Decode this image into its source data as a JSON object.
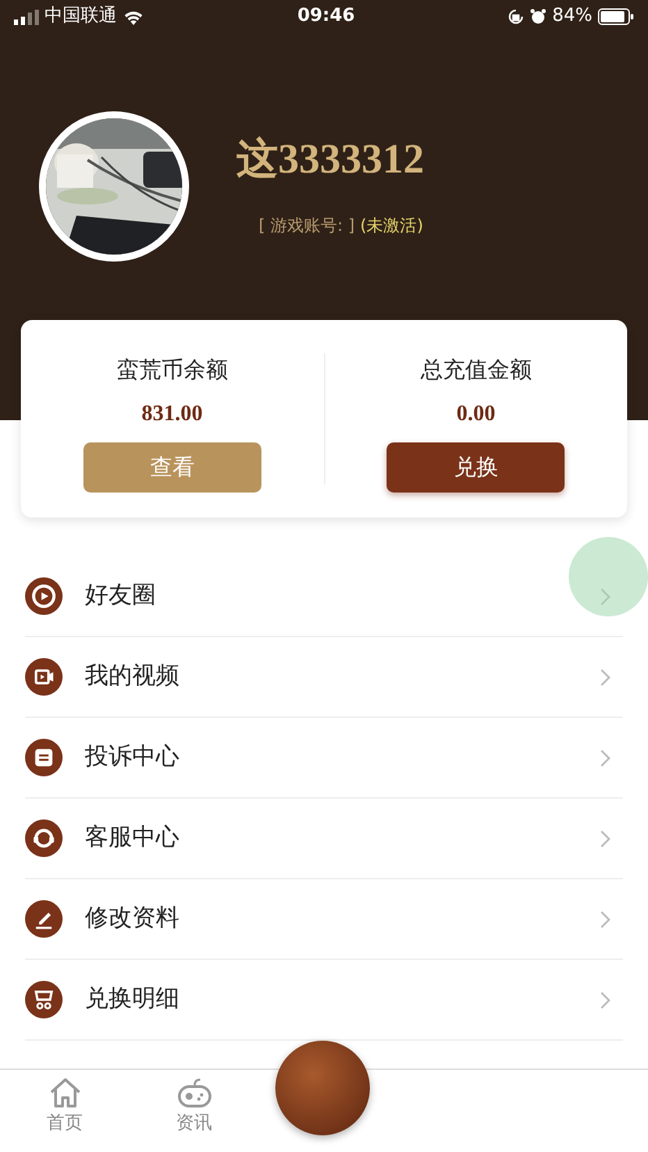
{
  "status_bar": {
    "carrier": "中国联通",
    "time": "09:46",
    "battery": "84%"
  },
  "profile": {
    "name": "这3333312",
    "account_label": "[ 游戏账号: ]",
    "account_status": "(未激活)"
  },
  "balances": [
    {
      "label": "蛮荒币余额",
      "amount": "831.00",
      "button": "查看",
      "kind": "light"
    },
    {
      "label": "总充值金额",
      "amount": "0.00",
      "button": "兑换",
      "kind": "dark"
    }
  ],
  "menu": [
    {
      "label": "好友圈",
      "kind": "play"
    },
    {
      "label": "我的视频",
      "kind": "video"
    },
    {
      "label": "投诉中心",
      "kind": "message"
    },
    {
      "label": "客服中心",
      "kind": "headset"
    },
    {
      "label": "修改资料",
      "kind": "edit"
    },
    {
      "label": "兑换明细",
      "kind": "cart"
    }
  ],
  "tab_bar": [
    {
      "label": "首页",
      "kind": "home",
      "selected": false
    },
    {
      "label": "资讯",
      "kind": "gamepad",
      "selected": false
    }
  ]
}
